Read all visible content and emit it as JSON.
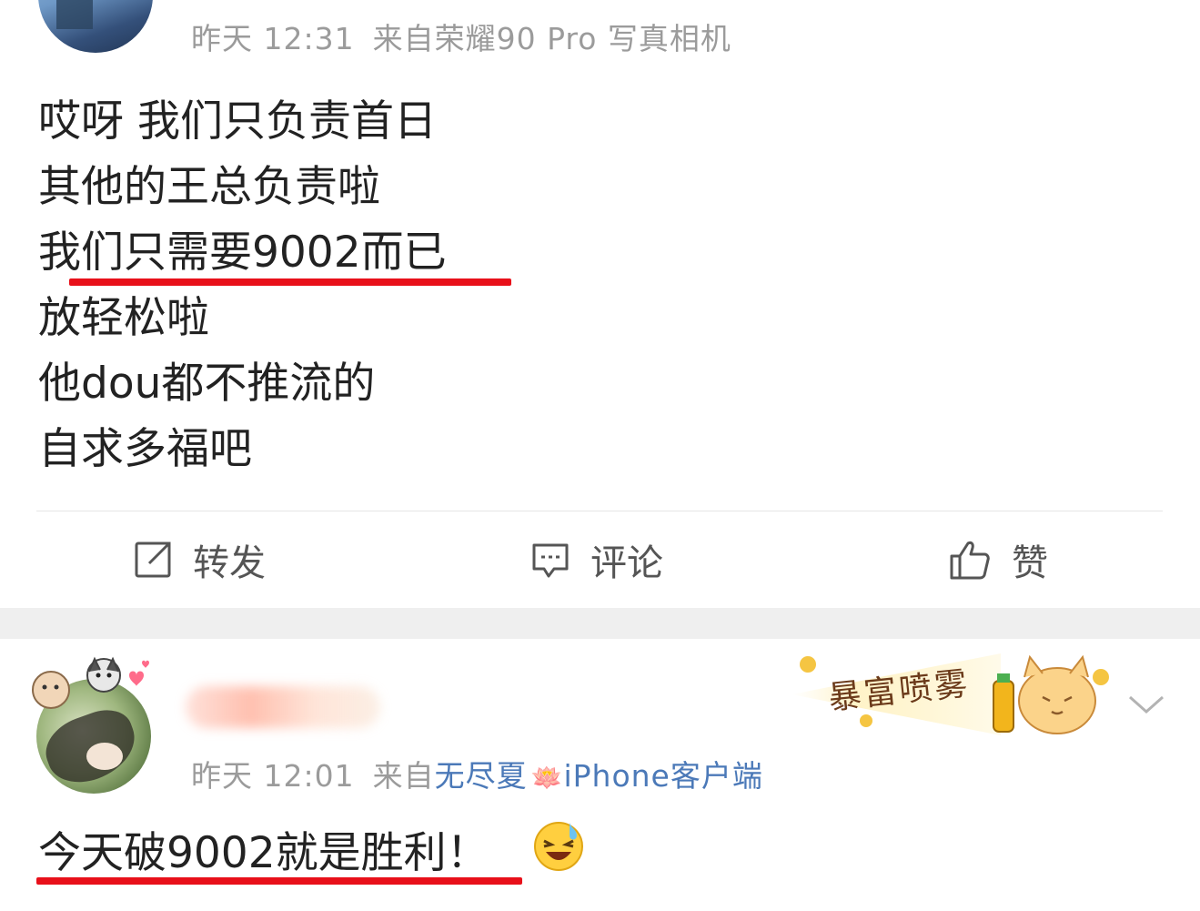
{
  "post1": {
    "meta": {
      "time": "昨天 12:31",
      "source": "来自荣耀90 Pro 写真相机"
    },
    "lines": [
      "哎呀 我们只负责首日",
      "其他的王总负责啦",
      "我们只需要9002而已",
      "放轻松啦",
      "他dou都不推流的",
      "自求多福吧"
    ],
    "actions": {
      "repost": "转发",
      "comment": "评论",
      "like": "赞"
    }
  },
  "post2": {
    "meta": {
      "time": "昨天 12:01",
      "from": "来自",
      "source": "无尽夏",
      "client": "iPhone客户端"
    },
    "badge_text": "暴富喷雾",
    "text": "今天破9002就是胜利！",
    "icons": {
      "lotus": "🪷"
    }
  },
  "colors": {
    "underline": "#e8101a",
    "link": "#4b79b8",
    "meta": "#9b9b9b"
  }
}
